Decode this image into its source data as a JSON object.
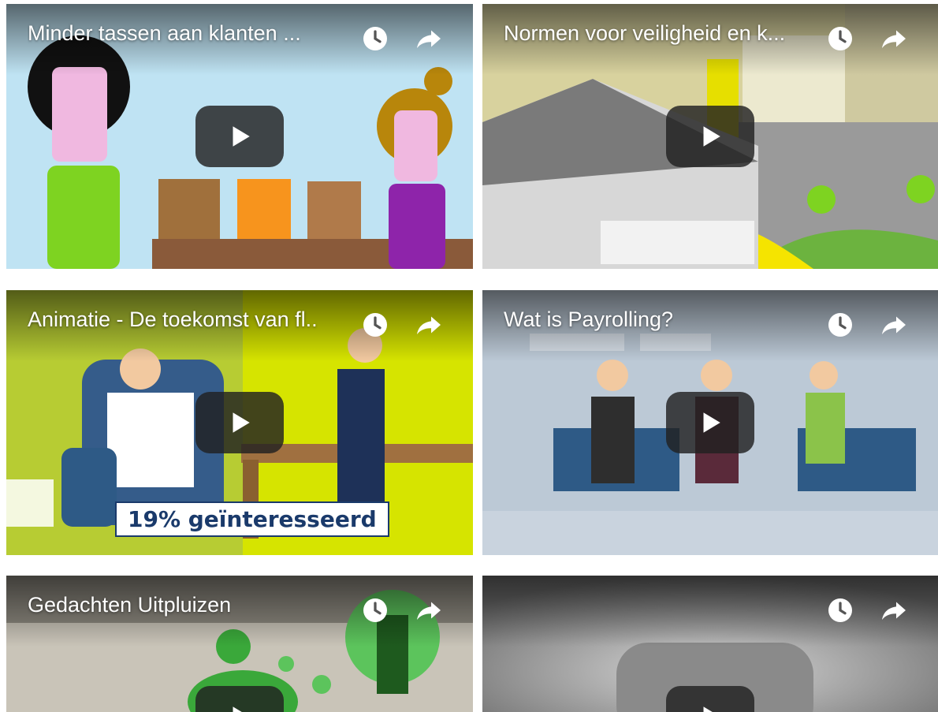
{
  "videos": [
    {
      "title": "Minder tassen aan klanten ...",
      "watch_later_icon": "clock-icon",
      "share_icon": "share-arrow-icon",
      "play_icon": "play-icon"
    },
    {
      "title": "Normen voor veiligheid en k...",
      "watch_later_icon": "clock-icon",
      "share_icon": "share-arrow-icon",
      "play_icon": "play-icon"
    },
    {
      "title": "Animatie - De toekomst van fl..",
      "watch_later_icon": "clock-icon",
      "share_icon": "share-arrow-icon",
      "play_icon": "play-icon",
      "overlay_text": "19% geïnteresseerd"
    },
    {
      "title": "Wat is Payrolling?",
      "watch_later_icon": "clock-icon",
      "share_icon": "share-arrow-icon",
      "play_icon": "play-icon"
    },
    {
      "title": "Gedachten Uitpluizen",
      "watch_later_icon": "clock-icon",
      "share_icon": "share-arrow-icon",
      "play_icon": "play-icon"
    },
    {
      "title": "",
      "watch_later_icon": "clock-icon",
      "share_icon": "share-arrow-icon",
      "play_icon": "play-icon"
    }
  ],
  "colors": {
    "play_button": "#212121",
    "icon": "#ffffff",
    "title_text": "#ffffff"
  }
}
